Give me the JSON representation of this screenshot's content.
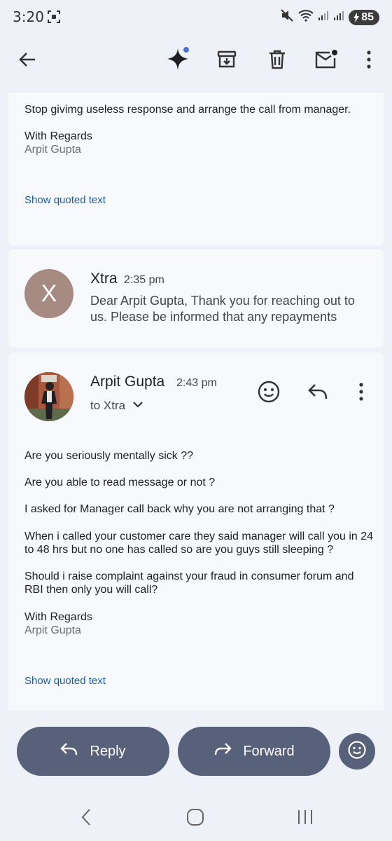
{
  "status_bar": {
    "time": "3:20",
    "battery": "85"
  },
  "toolbar": {
    "icons": [
      "back-arrow-icon",
      "gemini-sparkle-icon",
      "archive-icon",
      "delete-icon",
      "mark-unread-icon",
      "more-vert-icon"
    ]
  },
  "message1": {
    "body": "Stop givimg useless response and arrange the call from manager.",
    "regards": "With Regards",
    "signature": "Arpit Gupta",
    "show_quoted": "Show quoted text"
  },
  "message2": {
    "avatar_letter": "X",
    "sender": "Xtra",
    "time": "2:35 pm",
    "snippet": "Dear Arpit Gupta, Thank you for reaching out to us. Please be informed that any repayments"
  },
  "message3": {
    "sender": "Arpit Gupta",
    "time": "2:43 pm",
    "to": "to Xtra",
    "paragraphs": [
      "Are you seriously mentally sick ??",
      "Are you able to read message or not ?",
      "I asked for Manager call back why you are not arranging that ?",
      "When i called your customer care they said manager will call you in 24 to 48 hrs but no one has called so are you guys still sleeping ?",
      "Should i raise complaint against your fraud in consumer forum and RBI then only you will call?"
    ],
    "regards": "With Regards",
    "signature": "Arpit Gupta",
    "show_quoted": "Show quoted text"
  },
  "actions": {
    "reply": "Reply",
    "forward": "Forward"
  }
}
